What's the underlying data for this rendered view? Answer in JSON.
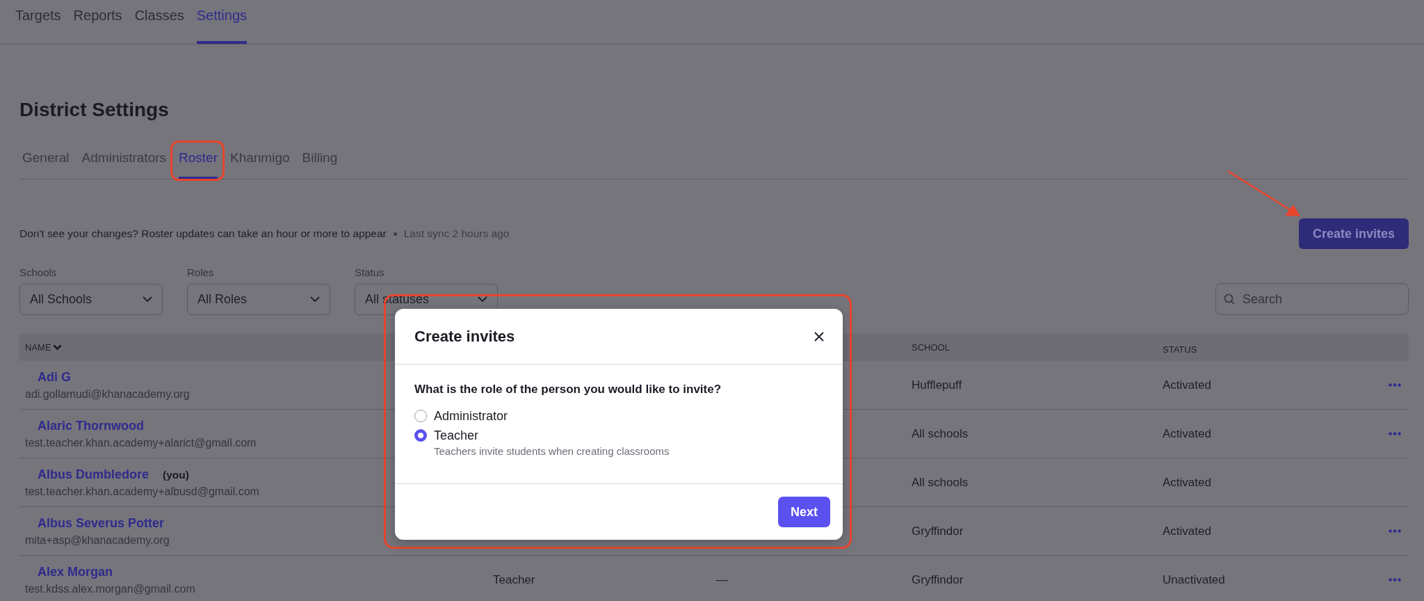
{
  "top_nav": [
    {
      "label": "Targets",
      "selected": false
    },
    {
      "label": "Reports",
      "selected": false
    },
    {
      "label": "Classes",
      "selected": false
    },
    {
      "label": "Settings",
      "selected": true
    }
  ],
  "page_title": "District Settings",
  "settings_tabs": [
    {
      "label": "General",
      "selected": false
    },
    {
      "label": "Administrators",
      "selected": false
    },
    {
      "label": "Roster",
      "selected": true,
      "highlighted": true
    },
    {
      "label": "Khanmigo",
      "selected": false
    },
    {
      "label": "Billing",
      "selected": false
    }
  ],
  "sync_notice": {
    "message": "Don't see your changes? Roster updates can take an hour or more to appear",
    "last_sync": "Last sync 2 hours ago"
  },
  "create_button": {
    "label": "Create invites",
    "highlighted": true
  },
  "filters": [
    {
      "label": "Schools",
      "value": "All Schools"
    },
    {
      "label": "Roles",
      "value": "All Roles"
    },
    {
      "label": "Status",
      "value": "All statuses"
    }
  ],
  "search": {
    "placeholder": "Search"
  },
  "table": {
    "columns": {
      "name": "NAME",
      "school": "SCHOOL",
      "status": "STATUS"
    },
    "rows": [
      {
        "name": "Adi G",
        "email": "adi.gollamudi@khanacademy.org",
        "school": "Hufflepuff",
        "status": "Activated",
        "menu": true
      },
      {
        "name": "Alaric Thornwood",
        "email": "test.teacher.khan.academy+alarict@gmail.com",
        "school": "All schools",
        "status": "Activated",
        "menu": true
      },
      {
        "name": "Albus Dumbledore",
        "you": "(you)",
        "email": "test.teacher.khan.academy+albusd@gmail.com",
        "school": "All schools",
        "status": "Activated",
        "menu": false
      },
      {
        "name": "Albus Severus Potter",
        "email": "mita+asp@khanacademy.org",
        "school": "Gryffindor",
        "status": "Activated",
        "menu": true
      },
      {
        "name": "Alex Morgan",
        "email": "test.kdss.alex.morgan@gmail.com",
        "role": "Teacher",
        "column_3": "—",
        "school": "Gryffindor",
        "status": "Unactivated",
        "menu": true
      }
    ]
  },
  "dialog": {
    "title": "Create invites",
    "highlighted": true,
    "question": "What is the role of the person you would like to invite?",
    "options": [
      {
        "label": "Administrator",
        "selected": false
      },
      {
        "label": "Teacher",
        "selected": true,
        "hint": "Teachers invite students when creating classrooms"
      }
    ],
    "next_button": "Next"
  }
}
